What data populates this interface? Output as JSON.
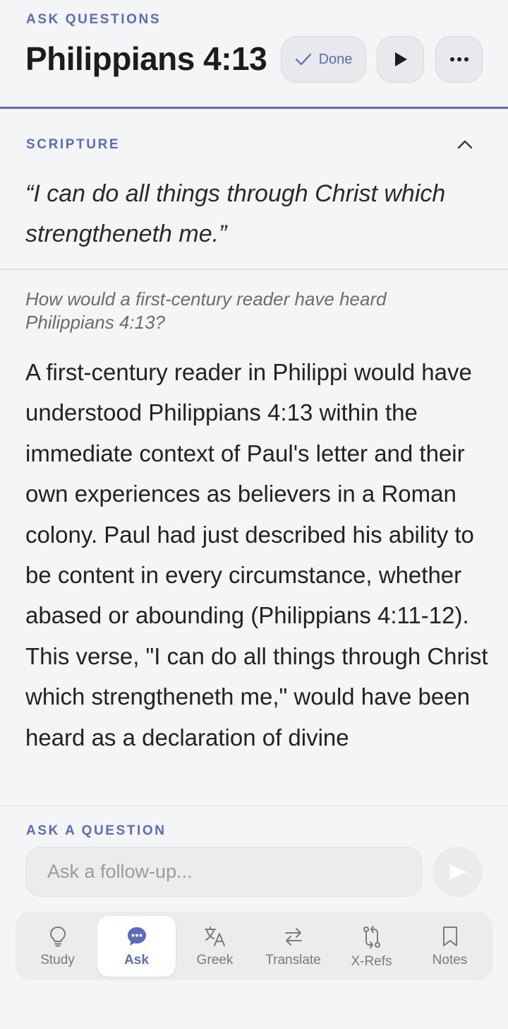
{
  "header": {
    "eyebrow": "ASK QUESTIONS",
    "title": "Philippians 4:13",
    "done_label": "Done"
  },
  "scripture": {
    "label": "SCRIPTURE",
    "verse": "“I can do all things through Christ which strengtheneth me.”"
  },
  "qa": {
    "question": "How would a first-century reader have heard Philippians 4:13?",
    "answer": "A first-century reader in Philippi would have understood Philippians 4:13 within the immediate context of Paul's letter and their own experiences as believers in a Roman colony. Paul had just described his ability to be content in every circumstance, whether abased or abounding (Philippians 4:11-12). This verse, \"I can do all things through Christ which strengtheneth me,\" would have been heard as a declaration of divine"
  },
  "ask": {
    "label": "ASK A QUESTION",
    "placeholder": "Ask a follow-up..."
  },
  "tabs": [
    {
      "label": "Study",
      "icon": "lightbulb-icon"
    },
    {
      "label": "Ask",
      "icon": "chat-bubble-icon"
    },
    {
      "label": "Greek",
      "icon": "translate-glyph-icon"
    },
    {
      "label": "Translate",
      "icon": "swap-arrows-icon"
    },
    {
      "label": "X-Refs",
      "icon": "cross-reference-icon"
    },
    {
      "label": "Notes",
      "icon": "bookmark-icon"
    }
  ],
  "colors": {
    "accent": "#5b6bc0",
    "background": "#f4f5f7"
  }
}
